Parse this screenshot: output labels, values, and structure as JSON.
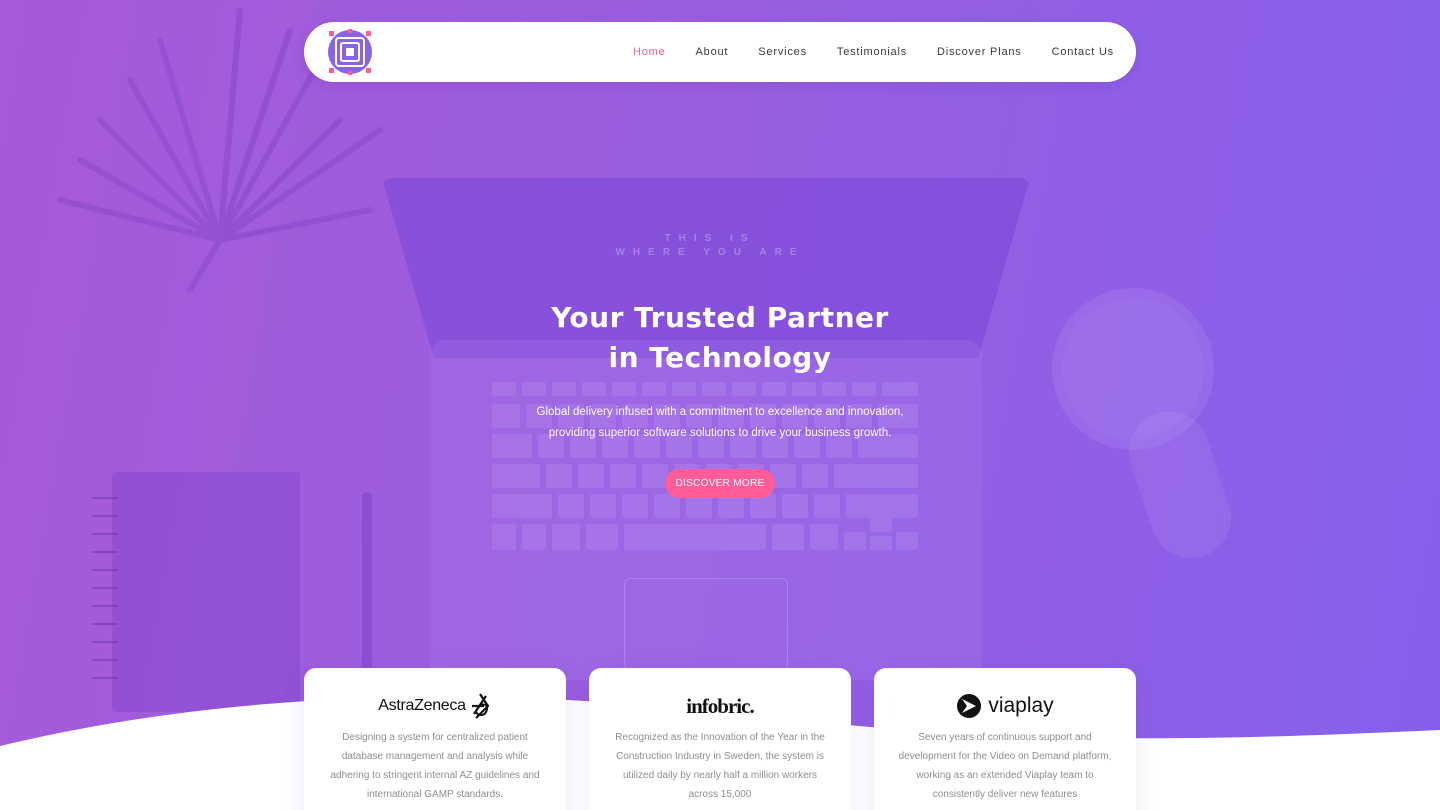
{
  "nav": {
    "logo_alt": "Company logo",
    "links": [
      {
        "label": "Home",
        "active": true
      },
      {
        "label": "About"
      },
      {
        "label": "Services"
      },
      {
        "label": "Testimonials"
      },
      {
        "label": "Discover Plans"
      },
      {
        "label": "Contact Us"
      }
    ]
  },
  "hero": {
    "title_line1": "Your Trusted Partner",
    "title_line2": "in Technology",
    "subtitle_line1": "Global delivery infused with a commitment to excellence and innovation,",
    "subtitle_line2": "providing superior software solutions to drive your business growth.",
    "cta_label": "DISCOVER MORE",
    "screen_line1": "THIS IS",
    "screen_line2": "WHERE YOU ARE"
  },
  "cards": [
    {
      "brand": "AstraZeneca",
      "text": "Designing a system for centralized patient database management and analysis while adhering to stringent internal AZ guidelines and international GAMP standards."
    },
    {
      "brand": "infobric.",
      "text": "Recognized as the Innovation of the Year in the Construction Industry in Sweden, the system is utilized daily by nearly half a million workers across 15,000"
    },
    {
      "brand": "viaplay",
      "text": "Seven years of continuous support and development for the Video on Demand platform, working as an extended Viaplay team to consistently deliver new features"
    }
  ],
  "colors": {
    "accent": "#ff5c9a",
    "nav_active": "#f06095",
    "hero_gradient_start": "#a75ad9",
    "hero_gradient_end": "#8560ec"
  }
}
